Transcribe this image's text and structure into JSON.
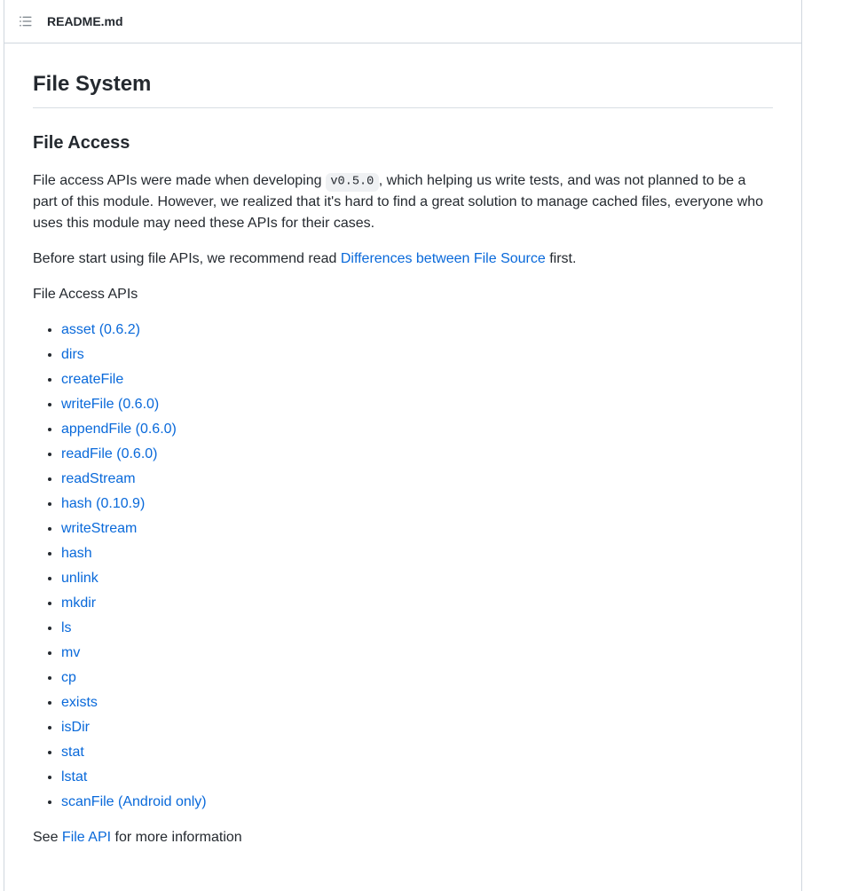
{
  "filename": "README.md",
  "heading_main": "File System",
  "heading_sub": "File Access",
  "para1_pre": "File access APIs were made when developing ",
  "para1_code": "v0.5.0",
  "para1_post": ", which helping us write tests, and was not planned to be a part of this module. However, we realized that it's hard to find a great solution to manage cached files, everyone who uses this module may need these APIs for their cases.",
  "para2_pre": "Before start using file APIs, we recommend read ",
  "para2_link": "Differences between File Source",
  "para2_post": " first.",
  "list_intro": "File Access APIs",
  "api_list": [
    "asset (0.6.2)",
    "dirs",
    "createFile",
    "writeFile (0.6.0)",
    "appendFile (0.6.0)",
    "readFile (0.6.0)",
    "readStream",
    "hash (0.10.9)",
    "writeStream",
    "hash",
    "unlink",
    "mkdir",
    "ls",
    "mv",
    "cp",
    "exists",
    "isDir",
    "stat",
    "lstat",
    "scanFile (Android only)"
  ],
  "footer_pre": "See ",
  "footer_link": "File API",
  "footer_post": " for more information"
}
